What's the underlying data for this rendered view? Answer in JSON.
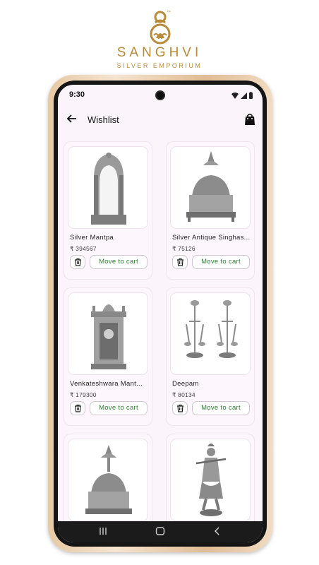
{
  "brand": {
    "name": "SANGHVI",
    "tagline": "SILVER EMPORIUM",
    "tm": "™"
  },
  "status": {
    "time": "9:30"
  },
  "appbar": {
    "title": "Wishlist",
    "back_icon": "arrow-left-icon",
    "cart_icon": "shopping-bag-icon"
  },
  "products": [
    {
      "name": "Silver Mantpa",
      "price": "₹ 394567",
      "action": "Move to cart",
      "image": "silver-mantapa"
    },
    {
      "name": "Silver Antique Singhas...",
      "price": "₹ 75126",
      "action": "Move to cart",
      "image": "silver-singhasan"
    },
    {
      "name": "Venkateshwara Mant...",
      "price": "₹ 179300",
      "action": "Move to cart",
      "image": "venkateshwara-mantapa"
    },
    {
      "name": "Deepam",
      "price": "₹ 80134",
      "action": "Move to cart",
      "image": "deepam-lamp"
    },
    {
      "name": "",
      "price": "",
      "action": "",
      "image": "silver-singhasan-2"
    },
    {
      "name": "",
      "price": "",
      "action": "",
      "image": "krishna-idol"
    }
  ],
  "colors": {
    "accent_green": "#2e7d32",
    "gold": "#b88a3a",
    "screen_bg": "#fbf5fb"
  }
}
